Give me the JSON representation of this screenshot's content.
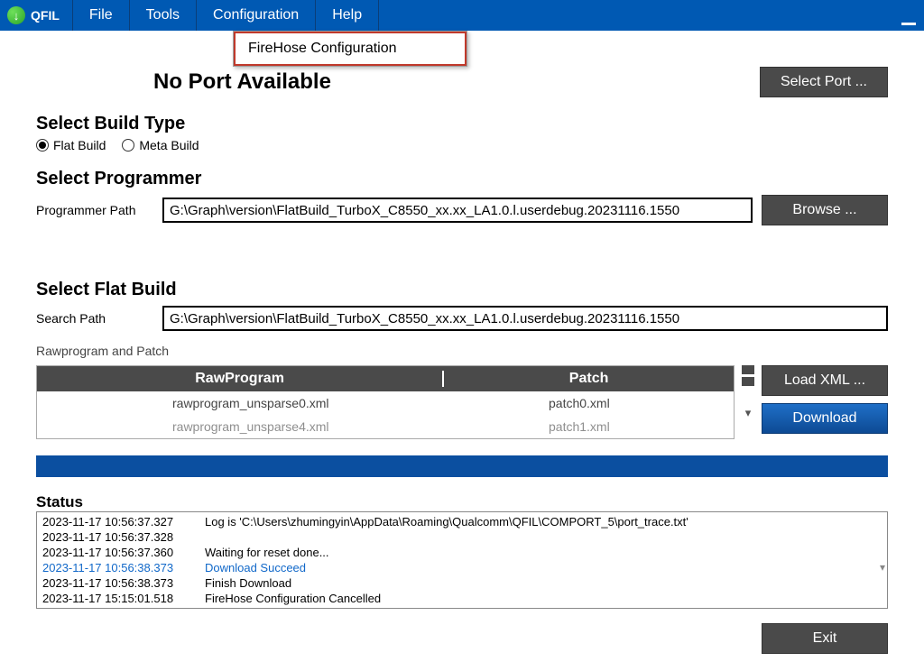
{
  "app": {
    "name": "QFIL"
  },
  "menu": {
    "file": "File",
    "tools": "Tools",
    "configuration": "Configuration",
    "help": "Help",
    "dropdown_item": "FireHose Configuration"
  },
  "port": {
    "status": "No Port Available",
    "select_btn": "Select Port ..."
  },
  "buildType": {
    "heading": "Select Build Type",
    "flat": "Flat Build",
    "meta": "Meta Build"
  },
  "programmer": {
    "heading": "Select Programmer",
    "label": "Programmer Path",
    "value": "G:\\Graph\\version\\FlatBuild_TurboX_C8550_xx.xx_LA1.0.l.userdebug.20231116.1550",
    "browse": "Browse ..."
  },
  "flatBuild": {
    "heading": "Select Flat Build",
    "label": "Search Path",
    "value": "G:\\Graph\\version\\FlatBuild_TurboX_C8550_xx.xx_LA1.0.l.userdebug.20231116.1550"
  },
  "rawpatch": {
    "label": "Rawprogram and Patch",
    "th_raw": "RawProgram",
    "th_patch": "Patch",
    "rows": [
      {
        "raw": "rawprogram_unsparse0.xml",
        "patch": "patch0.xml"
      },
      {
        "raw": "rawprogram_unsparse4.xml",
        "patch": "patch1.xml"
      }
    ],
    "load": "Load XML ...",
    "download": "Download"
  },
  "status": {
    "heading": "Status",
    "lines": [
      {
        "ts": "2023-11-17 10:56:37.327",
        "msg": "Log is 'C:\\Users\\zhumingyin\\AppData\\Roaming\\Qualcomm\\QFIL\\COMPORT_5\\port_trace.txt'"
      },
      {
        "ts": "2023-11-17 10:56:37.328",
        "msg": ""
      },
      {
        "ts": "2023-11-17 10:56:37.360",
        "msg": "Waiting for reset done..."
      },
      {
        "ts": "2023-11-17 10:56:38.373",
        "msg": "Download Succeed",
        "link": true
      },
      {
        "ts": "2023-11-17 10:56:38.373",
        "msg": "Finish Download"
      },
      {
        "ts": "2023-11-17 15:15:01.518",
        "msg": "FireHose Configuration Cancelled"
      }
    ]
  },
  "exit": "Exit"
}
